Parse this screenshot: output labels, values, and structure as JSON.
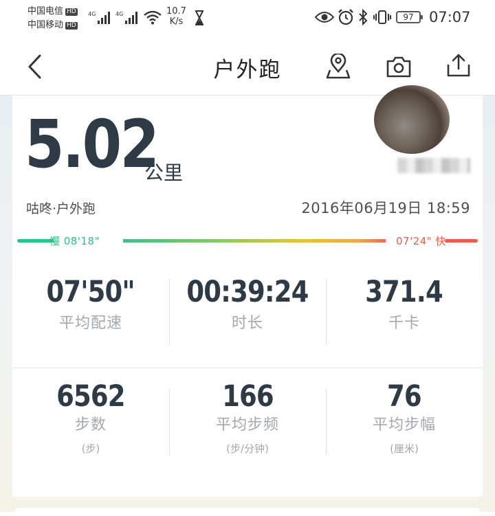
{
  "status_bar": {
    "carrier1": "中国电信",
    "carrier2": "中国移动",
    "hd_badge": "HD",
    "network1": "4G",
    "network2": "4G",
    "speed_value": "10.7",
    "speed_unit": "K/s",
    "battery": "97",
    "time": "07:07"
  },
  "nav": {
    "title": "户外跑",
    "icons": [
      "back-icon",
      "location-pin-icon",
      "camera-icon",
      "share-icon"
    ]
  },
  "summary": {
    "distance": "5.02",
    "distance_unit": "公里",
    "sport_label": "咕咚·户外跑",
    "datetime": "2016年06月19日 18:59",
    "pace_slow": "慢 08'18\"",
    "pace_fast": "07'24\" 快"
  },
  "stats_row1": [
    {
      "value": "07'50\"",
      "label": "平均配速"
    },
    {
      "value": "00:39:24",
      "label": "时长"
    },
    {
      "value": "371.4",
      "label": "千卡"
    }
  ],
  "stats_row2": [
    {
      "value": "6562",
      "label": "步数",
      "unit": "(步)"
    },
    {
      "value": "166",
      "label": "平均步频",
      "unit": "(步/分钟)"
    },
    {
      "value": "76",
      "label": "平均步幅",
      "unit": "(厘米)"
    }
  ],
  "colors": {
    "text_dark": "#2e3a46",
    "slow_color": "#2fbf85",
    "fast_color": "#e5604c"
  }
}
